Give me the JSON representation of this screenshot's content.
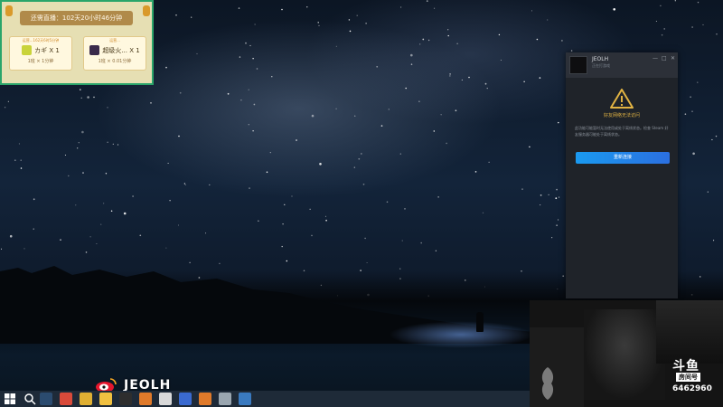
{
  "live_widget": {
    "banner_text": "还需直播：102天20小时46分钟",
    "gifts": [
      {
        "header": "运营...162天6时5分钟",
        "name": "カギ X 1",
        "sub": "1班 × 1分钟",
        "color": "#c9d33a"
      },
      {
        "header": "运营...",
        "name": "超级火... X 1",
        "sub": "1班 × 0.01分钟",
        "color": "#3a2a4a"
      }
    ]
  },
  "chat_window": {
    "name": "JEOLH",
    "status": "正在打游戏",
    "controls": [
      "—",
      "□",
      "✕"
    ],
    "warning_title": "好友网络无法访问",
    "warning_body": "此功能可能暂时无法使用或处于离线状态。检查 Steam 好友服务器可能处于离线状态。",
    "button_label": "重新连接",
    "accent": "#1a9af0",
    "warning_color": "#e1b343"
  },
  "camera": {
    "logo": "斗鱼",
    "room_label": "房间号",
    "room_id": "6462960"
  },
  "watermark": {
    "text": "JEOLH"
  },
  "taskbar": {
    "icons": [
      {
        "name": "steam-icon",
        "color": "#2b4b6f"
      },
      {
        "name": "chrome-icon",
        "color": "#d94a3a"
      },
      {
        "name": "app-icon",
        "color": "#e0b033"
      },
      {
        "name": "app-icon",
        "color": "#f0c040"
      },
      {
        "name": "obs-icon",
        "color": "#2e2e2e"
      },
      {
        "name": "app-icon",
        "color": "#e07a2a"
      },
      {
        "name": "app-icon",
        "color": "#d9d9d9"
      },
      {
        "name": "app-icon",
        "color": "#3a6ad0"
      },
      {
        "name": "app-icon",
        "color": "#e07a2a"
      },
      {
        "name": "app-icon",
        "color": "#9aa6b0"
      },
      {
        "name": "app-icon",
        "color": "#3a7ac0"
      }
    ]
  }
}
